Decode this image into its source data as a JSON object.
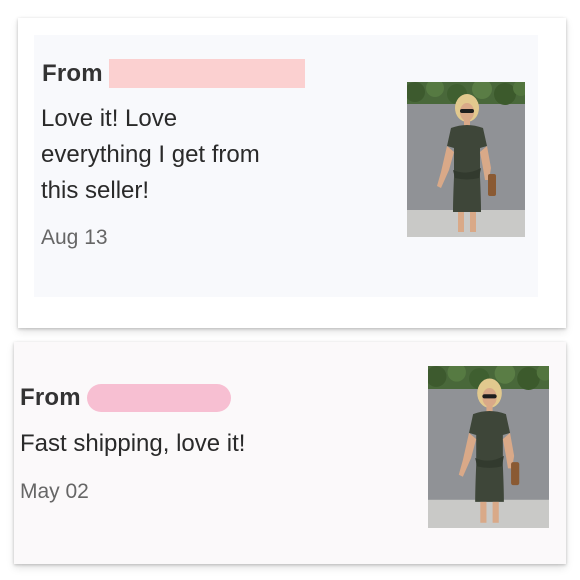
{
  "reviews": [
    {
      "from_label": "From",
      "message_lines": [
        "Love it! Love",
        "everything I get from",
        "this seller!"
      ],
      "date": "Aug 13",
      "image": "dress-product-photo"
    },
    {
      "from_label": "From",
      "message_lines": [
        "Fast shipping, love it!"
      ],
      "date": "May 02",
      "image": "dress-product-photo"
    }
  ],
  "colors": {
    "redaction_1": "#fbd0d0",
    "redaction_2": "#f7bfd2",
    "dress": "#3e4639",
    "card_1_bg": "#f8f9fc",
    "card_2_bg": "#fbf9fa"
  }
}
